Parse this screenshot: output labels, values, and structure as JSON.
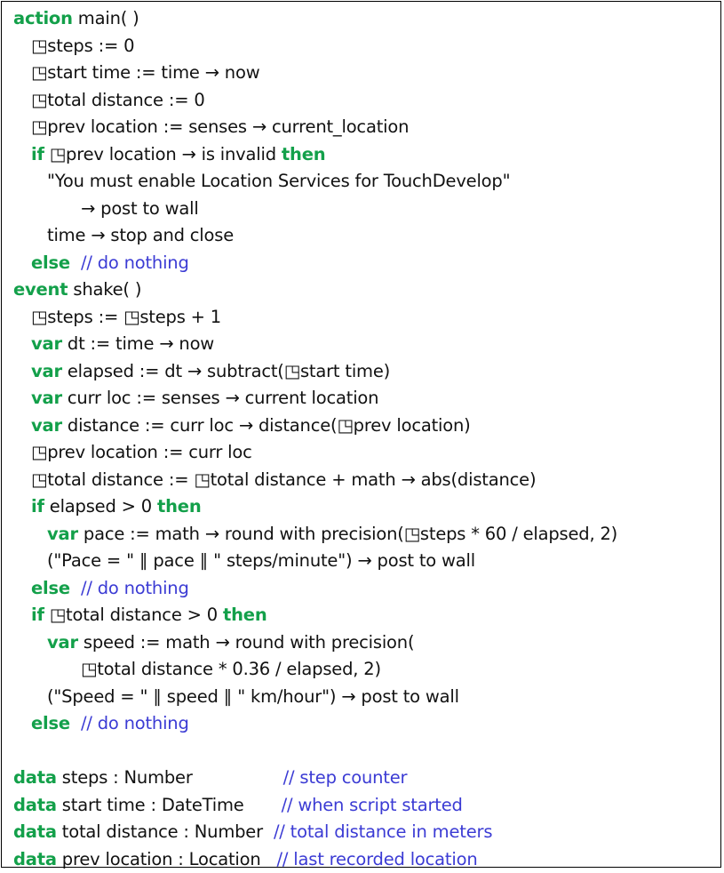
{
  "lines": [
    {
      "indent": 0,
      "parts": [
        {
          "t": "action",
          "c": "kwb"
        },
        {
          "t": " main( )"
        }
      ]
    },
    {
      "indent": 1,
      "parts": [
        {
          "t": "◳",
          "c": "gl"
        },
        {
          "t": "steps := 0"
        }
      ]
    },
    {
      "indent": 1,
      "parts": [
        {
          "t": "◳",
          "c": "gl"
        },
        {
          "t": "start time := time → now"
        }
      ]
    },
    {
      "indent": 1,
      "parts": [
        {
          "t": "◳",
          "c": "gl"
        },
        {
          "t": "total distance := 0"
        }
      ]
    },
    {
      "indent": 1,
      "parts": [
        {
          "t": "◳",
          "c": "gl"
        },
        {
          "t": "prev location := senses → current_location"
        }
      ]
    },
    {
      "indent": 1,
      "parts": [
        {
          "t": "if",
          "c": "kwb"
        },
        {
          "t": " "
        },
        {
          "t": "◳",
          "c": "gl"
        },
        {
          "t": "prev location → is invalid "
        },
        {
          "t": "then",
          "c": "kwb"
        }
      ]
    },
    {
      "indent": 2,
      "parts": [
        {
          "t": "\"You must enable Location Services for TouchDevelop\""
        }
      ]
    },
    {
      "indent": 4,
      "parts": [
        {
          "t": "→ post to wall"
        }
      ]
    },
    {
      "indent": 2,
      "parts": [
        {
          "t": "time → stop and close"
        }
      ]
    },
    {
      "indent": 1,
      "parts": [
        {
          "t": "else",
          "c": "kwb"
        },
        {
          "t": "  "
        },
        {
          "t": "// do nothing",
          "c": "cm"
        }
      ]
    },
    {
      "indent": 0,
      "parts": [
        {
          "t": "event",
          "c": "kwb"
        },
        {
          "t": " shake( )"
        }
      ]
    },
    {
      "indent": 1,
      "parts": [
        {
          "t": "◳",
          "c": "gl"
        },
        {
          "t": "steps := "
        },
        {
          "t": "◳",
          "c": "gl"
        },
        {
          "t": "steps + 1"
        }
      ]
    },
    {
      "indent": 1,
      "parts": [
        {
          "t": "var",
          "c": "kwb"
        },
        {
          "t": " dt := time → now"
        }
      ]
    },
    {
      "indent": 1,
      "parts": [
        {
          "t": "var",
          "c": "kwb"
        },
        {
          "t": " elapsed := dt → subtract("
        },
        {
          "t": "◳",
          "c": "gl"
        },
        {
          "t": "start time)"
        }
      ]
    },
    {
      "indent": 1,
      "parts": [
        {
          "t": "var",
          "c": "kwb"
        },
        {
          "t": " curr loc := senses → current location"
        }
      ]
    },
    {
      "indent": 1,
      "parts": [
        {
          "t": "var",
          "c": "kwb"
        },
        {
          "t": " distance := curr loc → distance("
        },
        {
          "t": "◳",
          "c": "gl"
        },
        {
          "t": "prev location)"
        }
      ]
    },
    {
      "indent": 1,
      "parts": [
        {
          "t": "◳",
          "c": "gl"
        },
        {
          "t": "prev location := curr loc"
        }
      ]
    },
    {
      "indent": 1,
      "parts": [
        {
          "t": "◳",
          "c": "gl"
        },
        {
          "t": "total distance := "
        },
        {
          "t": "◳",
          "c": "gl"
        },
        {
          "t": "total distance + math → abs(distance)"
        }
      ]
    },
    {
      "indent": 1,
      "parts": [
        {
          "t": "if",
          "c": "kwb"
        },
        {
          "t": " elapsed > 0 "
        },
        {
          "t": "then",
          "c": "kwb"
        }
      ]
    },
    {
      "indent": 2,
      "parts": [
        {
          "t": "var",
          "c": "kwb"
        },
        {
          "t": " pace := math → round with precision("
        },
        {
          "t": "◳",
          "c": "gl"
        },
        {
          "t": "steps * 60 / elapsed, 2)"
        }
      ]
    },
    {
      "indent": 2,
      "parts": [
        {
          "t": "(\"Pace = \" ∥ pace ∥ \" steps/minute\") → post to wall"
        }
      ]
    },
    {
      "indent": 1,
      "parts": [
        {
          "t": "else",
          "c": "kwb"
        },
        {
          "t": "  "
        },
        {
          "t": "// do nothing",
          "c": "cm"
        }
      ]
    },
    {
      "indent": 1,
      "parts": [
        {
          "t": "if",
          "c": "kwb"
        },
        {
          "t": " "
        },
        {
          "t": "◳",
          "c": "gl"
        },
        {
          "t": "total distance > 0 "
        },
        {
          "t": "then",
          "c": "kwb"
        }
      ]
    },
    {
      "indent": 2,
      "parts": [
        {
          "t": "var",
          "c": "kwb"
        },
        {
          "t": " speed := math → round with precision("
        }
      ]
    },
    {
      "indent": 4,
      "parts": [
        {
          "t": "◳",
          "c": "gl"
        },
        {
          "t": "total distance * 0.36 / elapsed, 2)"
        }
      ]
    },
    {
      "indent": 2,
      "parts": [
        {
          "t": "(\"Speed = \" ∥ speed ∥ \" km/hour\") → post to wall"
        }
      ]
    },
    {
      "indent": 1,
      "parts": [
        {
          "t": "else",
          "c": "kwb"
        },
        {
          "t": "  "
        },
        {
          "t": "// do nothing",
          "c": "cm"
        }
      ]
    },
    {
      "blank": true
    },
    {
      "indent": 0,
      "parts": [
        {
          "t": "data",
          "c": "kwb"
        },
        {
          "t": " steps : Number                 "
        },
        {
          "t": "// step counter",
          "c": "cm"
        }
      ]
    },
    {
      "indent": 0,
      "parts": [
        {
          "t": "data",
          "c": "kwb"
        },
        {
          "t": " start time : DateTime       "
        },
        {
          "t": "// when script started",
          "c": "cm"
        }
      ]
    },
    {
      "indent": 0,
      "parts": [
        {
          "t": "data",
          "c": "kwb"
        },
        {
          "t": " total distance : Number  "
        },
        {
          "t": "// total distance in meters",
          "c": "cm"
        }
      ]
    },
    {
      "indent": 0,
      "parts": [
        {
          "t": "data",
          "c": "kwb"
        },
        {
          "t": " prev location : Location   "
        },
        {
          "t": "// last recorded location",
          "c": "cm"
        }
      ]
    }
  ],
  "colors": {
    "keyword": "#13a04a",
    "comment": "#3b3bd4",
    "text": "#111111",
    "border": "#000000"
  }
}
